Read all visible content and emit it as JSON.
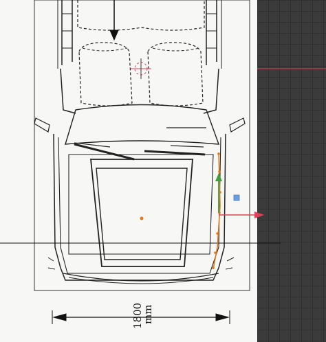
{
  "dimension": {
    "value_label": "1800",
    "unit_label": "mm"
  },
  "colors": {
    "paper": "#f7f7f5",
    "grid_background": "#3b3b3b",
    "guide_red": "#e0405a",
    "gizmo_green": "#3ca23c",
    "selection_orange": "#e07a1a",
    "gizmo_blue": "#6a9ee0"
  },
  "icons": {
    "transform_gizmo": "move-gizmo-icon",
    "cursor": "3d-cursor-icon"
  }
}
